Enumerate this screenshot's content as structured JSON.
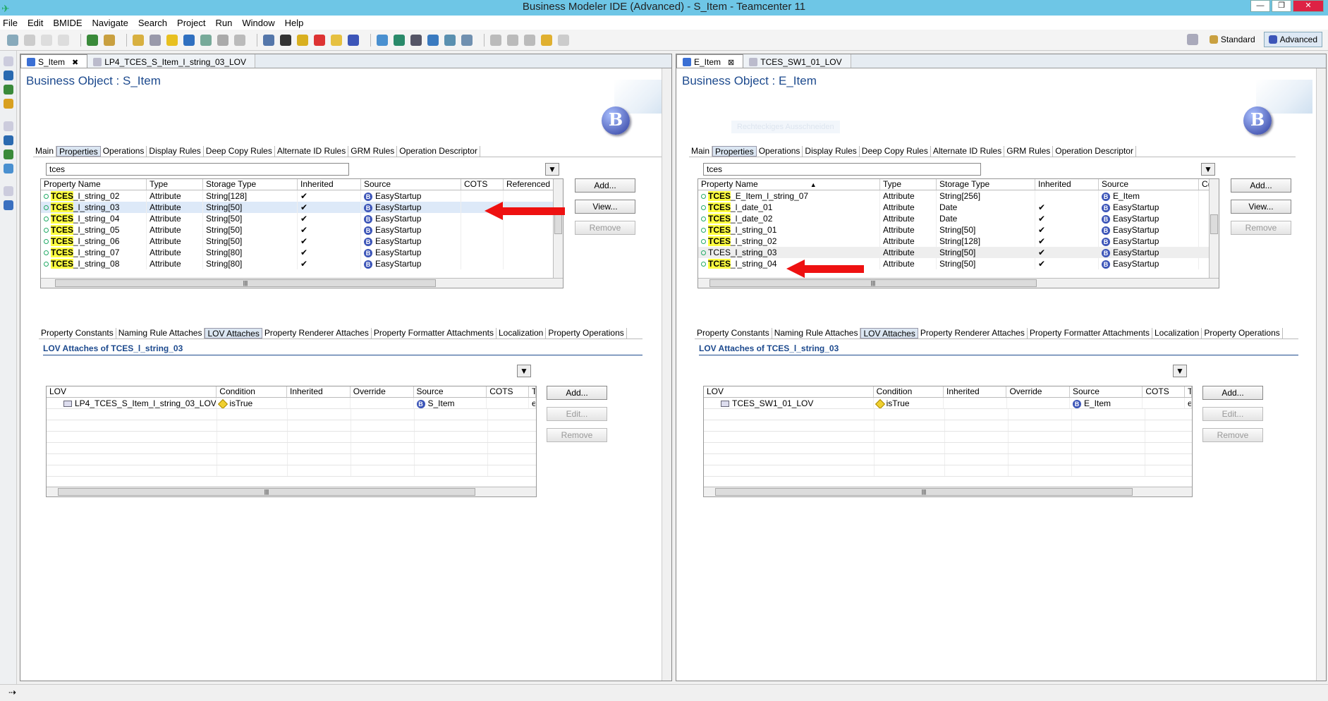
{
  "window": {
    "title": "Business Modeler IDE (Advanced) - S_Item - Teamcenter 11"
  },
  "menu": [
    "File",
    "Edit",
    "BMIDE",
    "Navigate",
    "Search",
    "Project",
    "Run",
    "Window",
    "Help"
  ],
  "perspectives": {
    "standard": "Standard",
    "advanced": "Advanced"
  },
  "left": {
    "tabs": [
      {
        "label": "S_Item"
      },
      {
        "label": "LP4_TCES_S_Item_l_string_03_LOV"
      }
    ],
    "title": "Business Object : S_Item",
    "main_tabs": [
      "Main",
      "Properties",
      "Operations",
      "Display Rules",
      "Deep Copy Rules",
      "Alternate ID Rules",
      "GRM Rules",
      "Operation Descriptor"
    ],
    "filter": "tces",
    "columns": [
      "Property Name",
      "Type",
      "Storage Type",
      "Inherited",
      "Source",
      "COTS",
      "Referenced"
    ],
    "rows": [
      {
        "hl": "TCES",
        "rest": "_l_string_02",
        "type": "Attribute",
        "storage": "String[128]",
        "inherited": "✔",
        "source": "EasyStartup"
      },
      {
        "hl": "TCES",
        "rest": "_l_string_03",
        "type": "Attribute",
        "storage": "String[50]",
        "inherited": "✔",
        "source": "EasyStartup"
      },
      {
        "hl": "TCES",
        "rest": "_l_string_04",
        "type": "Attribute",
        "storage": "String[50]",
        "inherited": "✔",
        "source": "EasyStartup"
      },
      {
        "hl": "TCES",
        "rest": "_l_string_05",
        "type": "Attribute",
        "storage": "String[50]",
        "inherited": "✔",
        "source": "EasyStartup"
      },
      {
        "hl": "TCES",
        "rest": "_l_string_06",
        "type": "Attribute",
        "storage": "String[50]",
        "inherited": "✔",
        "source": "EasyStartup"
      },
      {
        "hl": "TCES",
        "rest": "_l_string_07",
        "type": "Attribute",
        "storage": "String[80]",
        "inherited": "✔",
        "source": "EasyStartup"
      },
      {
        "hl": "TCES",
        "rest": "_l_string_08",
        "type": "Attribute",
        "storage": "String[80]",
        "inherited": "✔",
        "source": "EasyStartup"
      }
    ],
    "buttons": {
      "add": "Add...",
      "view": "View...",
      "remove": "Remove"
    },
    "sub_tabs": [
      "Property Constants",
      "Naming Rule Attaches",
      "LOV Attaches",
      "Property Renderer Attaches",
      "Property Formatter Attachments",
      "Localization",
      "Property Operations"
    ],
    "lov_title": "LOV Attaches of TCES_l_string_03",
    "lov_columns": [
      "LOV",
      "Condition",
      "Inherited",
      "Override",
      "Source",
      "COTS",
      "T"
    ],
    "lov_row": {
      "lov": "LP4_TCES_S_Item_l_string_03_LOV",
      "condition": "isTrue",
      "source": "S_Item",
      "tail": "e"
    },
    "lov_buttons": {
      "add": "Add...",
      "edit": "Edit...",
      "remove": "Remove"
    }
  },
  "right": {
    "tabs": [
      {
        "label": "E_Item"
      },
      {
        "label": "TCES_SW1_01_LOV"
      }
    ],
    "title": "Business Object : E_Item",
    "ghost": "Rechteckiges Ausschneiden",
    "main_tabs": [
      "Main",
      "Properties",
      "Operations",
      "Display Rules",
      "Deep Copy Rules",
      "Alternate ID Rules",
      "GRM Rules",
      "Operation Descriptor"
    ],
    "filter": "tces",
    "columns": [
      "Property Name",
      "Type",
      "Storage Type",
      "Inherited",
      "Source",
      "C("
    ],
    "rows": [
      {
        "hl": "TCES",
        "rest": "_E_Item_l_string_07",
        "type": "Attribute",
        "storage": "String[256]",
        "inherited": "",
        "source": "E_Item"
      },
      {
        "hl": "TCES",
        "rest": "_l_date_01",
        "type": "Attribute",
        "storage": "Date",
        "inherited": "✔",
        "source": "EasyStartup"
      },
      {
        "hl": "TCES",
        "rest": "_l_date_02",
        "type": "Attribute",
        "storage": "Date",
        "inherited": "✔",
        "source": "EasyStartup"
      },
      {
        "hl": "TCES",
        "rest": "_l_string_01",
        "type": "Attribute",
        "storage": "String[50]",
        "inherited": "✔",
        "source": "EasyStartup"
      },
      {
        "hl": "TCES",
        "rest": "_l_string_02",
        "type": "Attribute",
        "storage": "String[128]",
        "inherited": "✔",
        "source": "EasyStartup"
      },
      {
        "hl": "",
        "rest": "TCES_l_string_03",
        "type": "Attribute",
        "storage": "String[50]",
        "inherited": "✔",
        "source": "EasyStartup"
      },
      {
        "hl": "TCES",
        "rest": "_l_string_04",
        "type": "Attribute",
        "storage": "String[50]",
        "inherited": "✔",
        "source": "EasyStartup"
      }
    ],
    "buttons": {
      "add": "Add...",
      "view": "View...",
      "remove": "Remove"
    },
    "sub_tabs": [
      "Property Constants",
      "Naming Rule Attaches",
      "LOV Attaches",
      "Property Renderer Attaches",
      "Property Formatter Attachments",
      "Localization",
      "Property Operations"
    ],
    "lov_title": "LOV Attaches of TCES_l_string_03",
    "lov_columns": [
      "LOV",
      "Condition",
      "Inherited",
      "Override",
      "Source",
      "COTS",
      "T"
    ],
    "lov_row": {
      "lov": "TCES_SW1_01_LOV",
      "condition": "isTrue",
      "source": "E_Item",
      "tail": "e"
    },
    "lov_buttons": {
      "add": "Add...",
      "edit": "Edit...",
      "remove": "Remove"
    }
  }
}
